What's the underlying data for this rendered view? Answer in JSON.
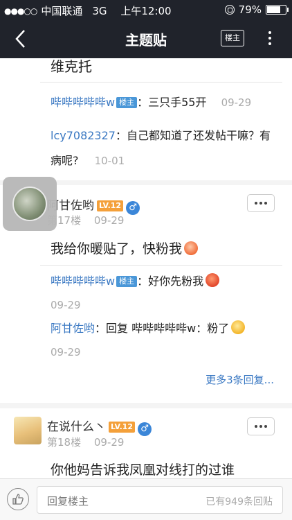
{
  "status": {
    "carrier": "中国联通",
    "network": "3G",
    "time": "上午12:00",
    "battery": "79%",
    "battery_level": 0.79
  },
  "nav": {
    "title": "主题贴",
    "louzhu_button": "楼主"
  },
  "post_prev": {
    "tail_text": "维克托",
    "replies": [
      {
        "user": "哔哔哔哔哔w",
        "tag": "楼主",
        "text": "：三只手55开",
        "date": "09-29"
      },
      {
        "user": "lcy7082327",
        "text": "：自己都知道了还发帖干嘛？有病呢?",
        "date": "10-01"
      }
    ]
  },
  "post_17": {
    "author": "阿甘佐哟",
    "level": "LV.12",
    "gender_icon": "♂",
    "floor": "第17楼",
    "date": "09-29",
    "body": "我给你暖贴了，快粉我",
    "replies": [
      {
        "user": "哔哔哔哔哔w",
        "tag": "楼主",
        "text": "：好你先粉我",
        "date": "09-29"
      },
      {
        "user": "阿甘佐哟",
        "text": "：回复 哔哔哔哔哔w：粉了",
        "date": "09-29"
      }
    ],
    "more_replies": "更多3条回复..."
  },
  "post_18": {
    "author": "在说什么丶",
    "level": "LV.12",
    "gender_icon": "♂",
    "floor": "第18楼",
    "date": "09-29",
    "body": "你他妈告诉我凤凰对线打的过谁"
  },
  "bottom": {
    "reply_placeholder": "回复楼主",
    "reply_count": "已有949条回贴"
  },
  "colors": {
    "bar": "#20232b",
    "link": "#3b79c3",
    "level_badge": "#f4a03a",
    "louzhu_tag": "#4a97d8"
  }
}
